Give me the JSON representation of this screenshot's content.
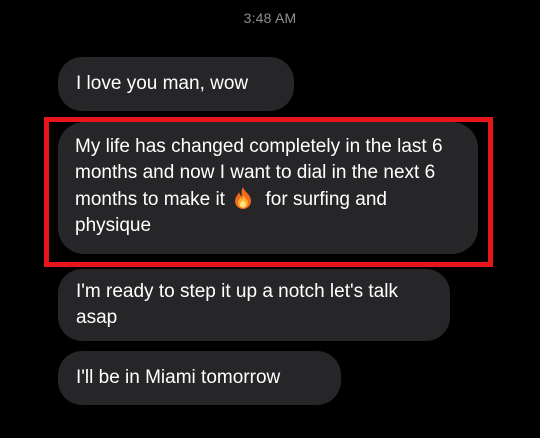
{
  "conversation": {
    "timestamp": "3:48 AM",
    "messages": [
      {
        "text": "I love you man, wow"
      },
      {
        "text_before_emoji": "My life has changed completely in the last 6 months and now I want to dial in the next 6 months to make it",
        "emoji": "fire",
        "text_after_emoji": "for surfing and physique",
        "highlighted": true
      },
      {
        "text": "I'm ready to step it up a notch let's talk asap"
      },
      {
        "text": "I'll be in Miami tomorrow"
      }
    ]
  },
  "colors": {
    "background": "#000000",
    "bubble": "#262628",
    "bubble_text": "#ffffff",
    "timestamp": "#8e8e93",
    "highlight": "#e8141b"
  }
}
